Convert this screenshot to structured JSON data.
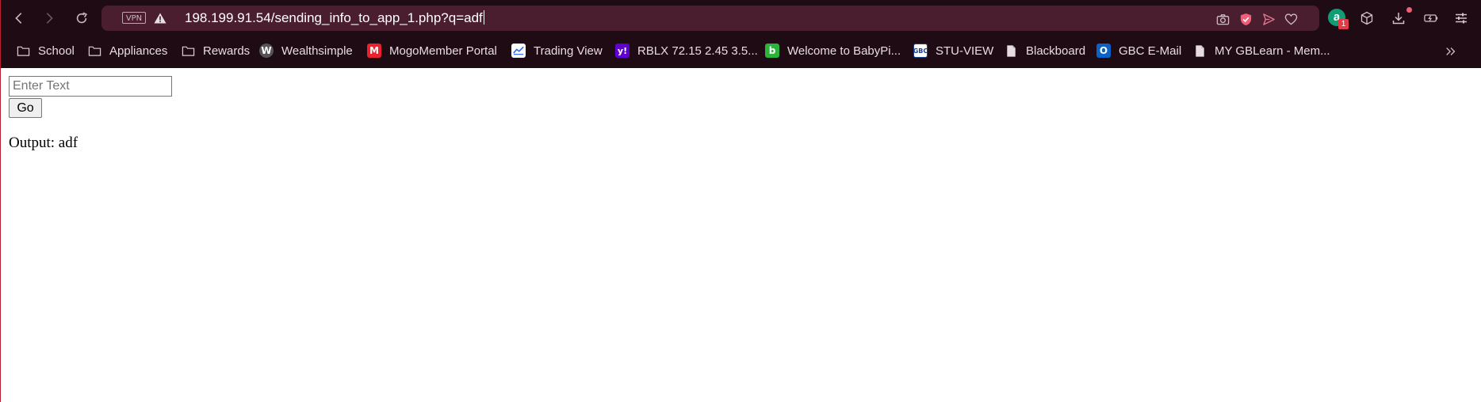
{
  "browser": {
    "vpn_badge": "VPN",
    "address_url": "198.199.91.54/sending_info_to_app_1.php?q=adf",
    "profile_initial": "a",
    "profile_badge_count": "1",
    "accent_color": "#e23b4a"
  },
  "bookmarks": [
    {
      "label": "School",
      "icon": "folder-icon"
    },
    {
      "label": "Appliances",
      "icon": "folder-icon"
    },
    {
      "label": "Rewards",
      "icon": "folder-icon"
    },
    {
      "label": "Wealthsimple",
      "icon": "wealthsimple-icon",
      "glyph": "W"
    },
    {
      "label": "MogoMember Portal",
      "icon": "mogo-icon",
      "glyph": "M"
    },
    {
      "label": "Trading View",
      "icon": "tradingview-icon"
    },
    {
      "label": "RBLX 72.15 2.45 3.5...",
      "icon": "yahoo-icon",
      "glyph": "y!"
    },
    {
      "label": "Welcome to BabyPi...",
      "icon": "babypips-icon",
      "glyph": "b"
    },
    {
      "label": "STU-VIEW",
      "icon": "gbc-icon",
      "glyph": "GBC"
    },
    {
      "label": "Blackboard",
      "icon": "page-icon"
    },
    {
      "label": "GBC E-Mail",
      "icon": "outlook-icon",
      "glyph": "O"
    },
    {
      "label": "MY GBLearn - Mem...",
      "icon": "page-icon"
    }
  ],
  "form": {
    "input_placeholder": "Enter Text",
    "input_value": "",
    "go_label": "Go"
  },
  "output": {
    "text": "Output: adf"
  }
}
